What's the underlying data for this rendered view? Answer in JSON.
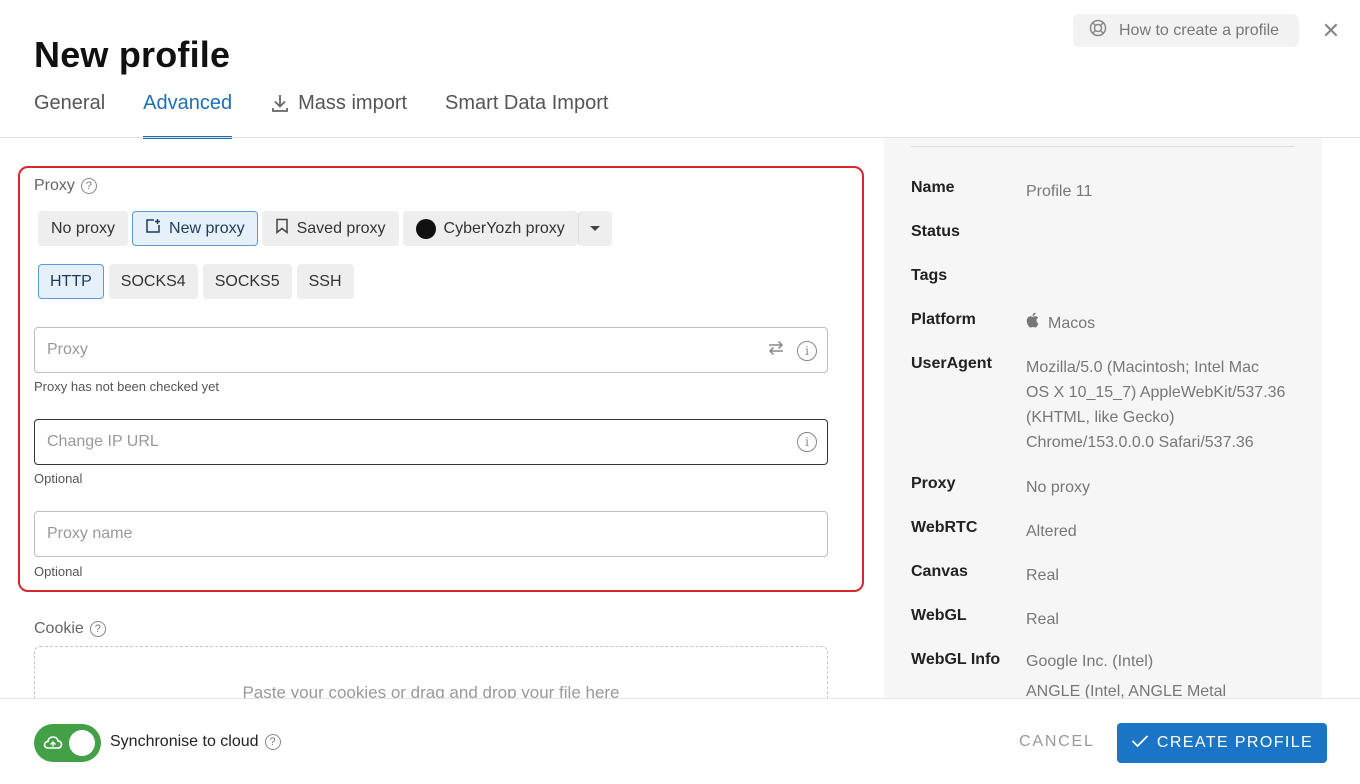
{
  "header": {
    "title": "New profile",
    "help_label": "How to create a profile"
  },
  "tabs": [
    {
      "label": "General"
    },
    {
      "label": "Advanced"
    },
    {
      "label": "Mass import"
    },
    {
      "label": "Smart Data Import"
    }
  ],
  "proxy": {
    "section_label": "Proxy",
    "modes": [
      "No proxy",
      "New proxy",
      "Saved proxy",
      "CyberYozh proxy"
    ],
    "selected_mode": "New proxy",
    "types": [
      "HTTP",
      "SOCKS4",
      "SOCKS5",
      "SSH"
    ],
    "selected_type": "HTTP",
    "proxy_placeholder": "Proxy",
    "proxy_helper": "Proxy has not been checked yet",
    "change_ip_placeholder": "Change IP URL",
    "change_ip_helper": "Optional",
    "name_placeholder": "Proxy name",
    "name_helper": "Optional"
  },
  "cookie": {
    "label": "Cookie",
    "drop_text": "Paste your cookies or drag and drop your file here"
  },
  "summary": [
    {
      "key": "Name",
      "value": "Profile 11"
    },
    {
      "key": "Status",
      "value": ""
    },
    {
      "key": "Tags",
      "value": ""
    },
    {
      "key": "Platform",
      "value": "Macos"
    },
    {
      "key": "UserAgent",
      "lines": [
        "Mozilla/5.0 (Macintosh; Intel Mac",
        "OS X 10_15_7) AppleWebKit/537.36",
        "(KHTML, like Gecko)",
        "Chrome/153.0.0.0 Safari/537.36"
      ]
    },
    {
      "key": "Proxy",
      "value": "No proxy"
    },
    {
      "key": "WebRTC",
      "value": "Altered"
    },
    {
      "key": "Canvas",
      "value": "Real"
    },
    {
      "key": "WebGL",
      "value": "Real"
    },
    {
      "key": "WebGL Info",
      "lines": [
        "Google Inc. (Intel)",
        "ANGLE (Intel, ANGLE Metal"
      ]
    }
  ],
  "footer": {
    "sync_label": "Synchronise to cloud",
    "sync_on": true,
    "cancel_label": "CANCEL",
    "create_label": "CREATE PROFILE"
  },
  "colors": {
    "accent": "#1b75c7",
    "highlight_border": "#d8262b",
    "toggle_on": "#43a047"
  }
}
